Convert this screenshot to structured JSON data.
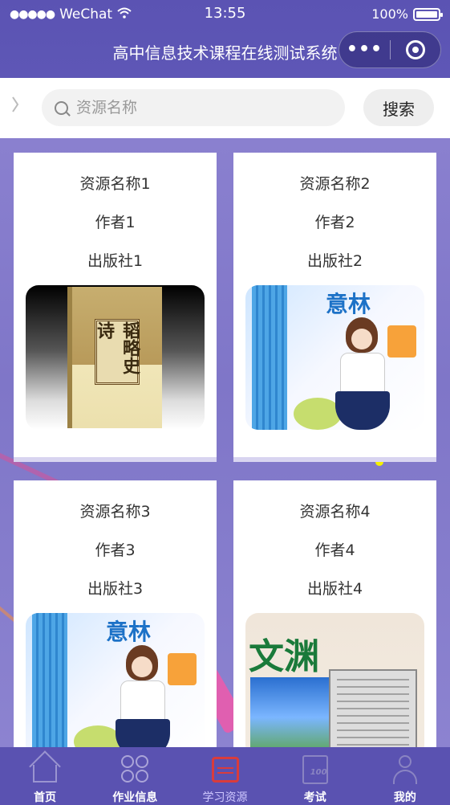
{
  "status_bar": {
    "signal": "●●●●●",
    "carrier": "WeChat",
    "time": "13:55",
    "battery_text": "100%"
  },
  "header": {
    "title": "高中信息技术课程在线测试系统",
    "more_label": "•••"
  },
  "search": {
    "placeholder": "资源名称",
    "button_label": "搜索"
  },
  "resources": [
    {
      "name": "资源名称1",
      "author": "作者1",
      "publisher": "出版社1",
      "cover": "book-cover-image"
    },
    {
      "name": "资源名称2",
      "author": "作者2",
      "publisher": "出版社2",
      "cover": "magazine-cover-image"
    },
    {
      "name": "资源名称3",
      "author": "作者3",
      "publisher": "出版社3",
      "cover": "magazine-cover-image"
    },
    {
      "name": "资源名称4",
      "author": "作者4",
      "publisher": "出版社4",
      "cover": "journal-cover-image"
    }
  ],
  "covers": {
    "book_text": "韬略史诗",
    "magazine_text": "意林",
    "journal_text": "文渊"
  },
  "tabbar": {
    "items": [
      {
        "label": "首页",
        "icon": "home-icon"
      },
      {
        "label": "作业信息",
        "icon": "clover-icon"
      },
      {
        "label": "学习资源",
        "icon": "calendar-icon",
        "active": true
      },
      {
        "label": "考试",
        "icon": "exam-icon"
      },
      {
        "label": "我的",
        "icon": "user-icon"
      }
    ]
  },
  "colors": {
    "primary": "#5a52b1",
    "active_tab": "#cfc8ff",
    "active_icon": "#d93c3c"
  }
}
